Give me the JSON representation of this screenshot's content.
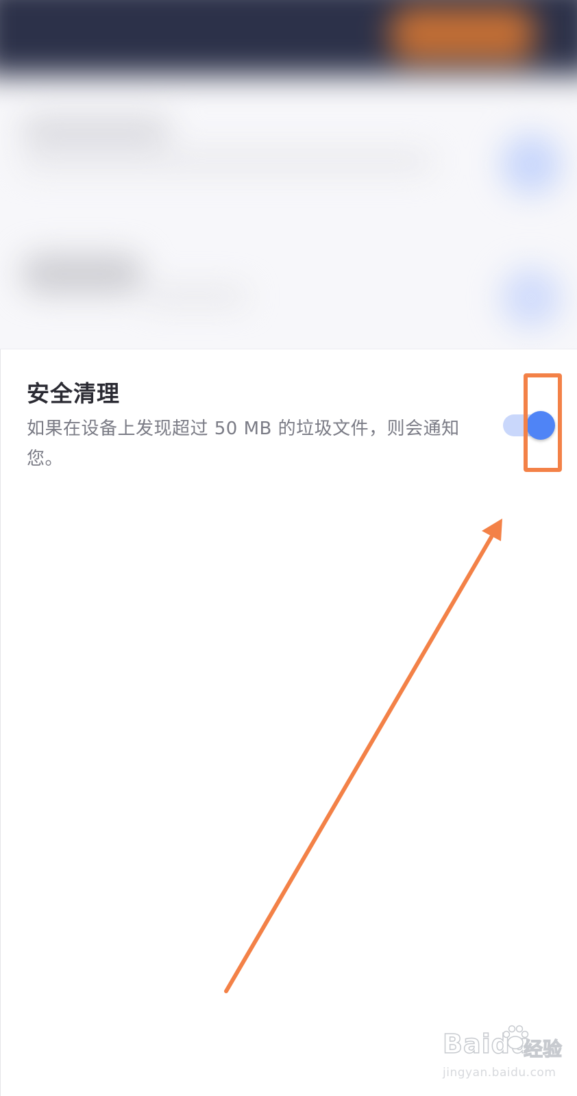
{
  "setting": {
    "title": "安全清理",
    "description": "如果在设备上发现超过 50 MB 的垃圾文件，则会通知您。",
    "toggle_state": "on"
  },
  "colors": {
    "accent": "#4f84f6",
    "toggle_track": "#c9d7fb",
    "annotation": "#f38147",
    "title_text": "#2b2b33",
    "description_text": "#7a7b85"
  },
  "annotation": {
    "highlight_target": "toggle",
    "arrow_target": "toggle"
  },
  "watermark": {
    "logo": "Baidu",
    "brand": "经验",
    "url": "jingyan.baidu.com"
  }
}
